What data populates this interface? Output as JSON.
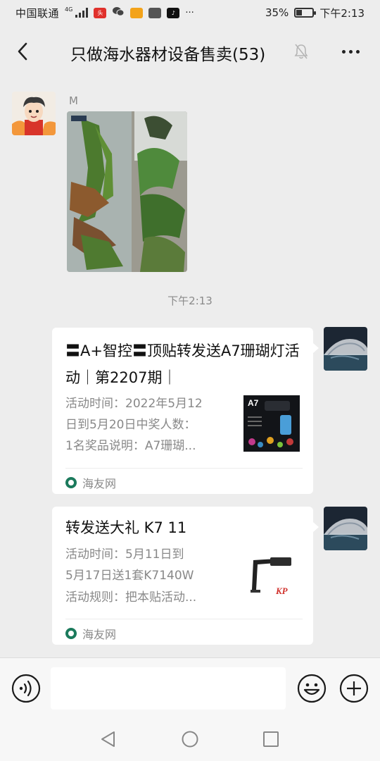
{
  "status_bar": {
    "carrier": "中国联通",
    "network": "4G",
    "battery_percent_label": "35%",
    "battery_level": 0.35,
    "time": "下午2:13",
    "more_label": "···"
  },
  "chat": {
    "title": "只做海水器材设备售卖(53)",
    "sender_name": "M",
    "time_divider": "下午2:13"
  },
  "cards": [
    {
      "title": "〓A+智控〓顶贴转发送A7珊瑚灯活动｜第2207期｜",
      "desc_lines": [
        "活动时间：2022年5月12",
        "日到5月20日中奖人数：",
        "1名奖品说明：A7珊瑚..."
      ],
      "thumb_text": "A7",
      "source": "海友网"
    },
    {
      "title": "转发送大礼 K7 11",
      "desc_lines": [
        "活动时间：5月11日到",
        "5月17日送1套K7140W",
        "活动规则：把本贴活动..."
      ],
      "thumb_text": "KP",
      "source": "海友网"
    }
  ],
  "input": {
    "placeholder": ""
  },
  "colors": {
    "background": "#ededed",
    "card": "#ffffff",
    "source_icon": "#1b7a5c"
  }
}
